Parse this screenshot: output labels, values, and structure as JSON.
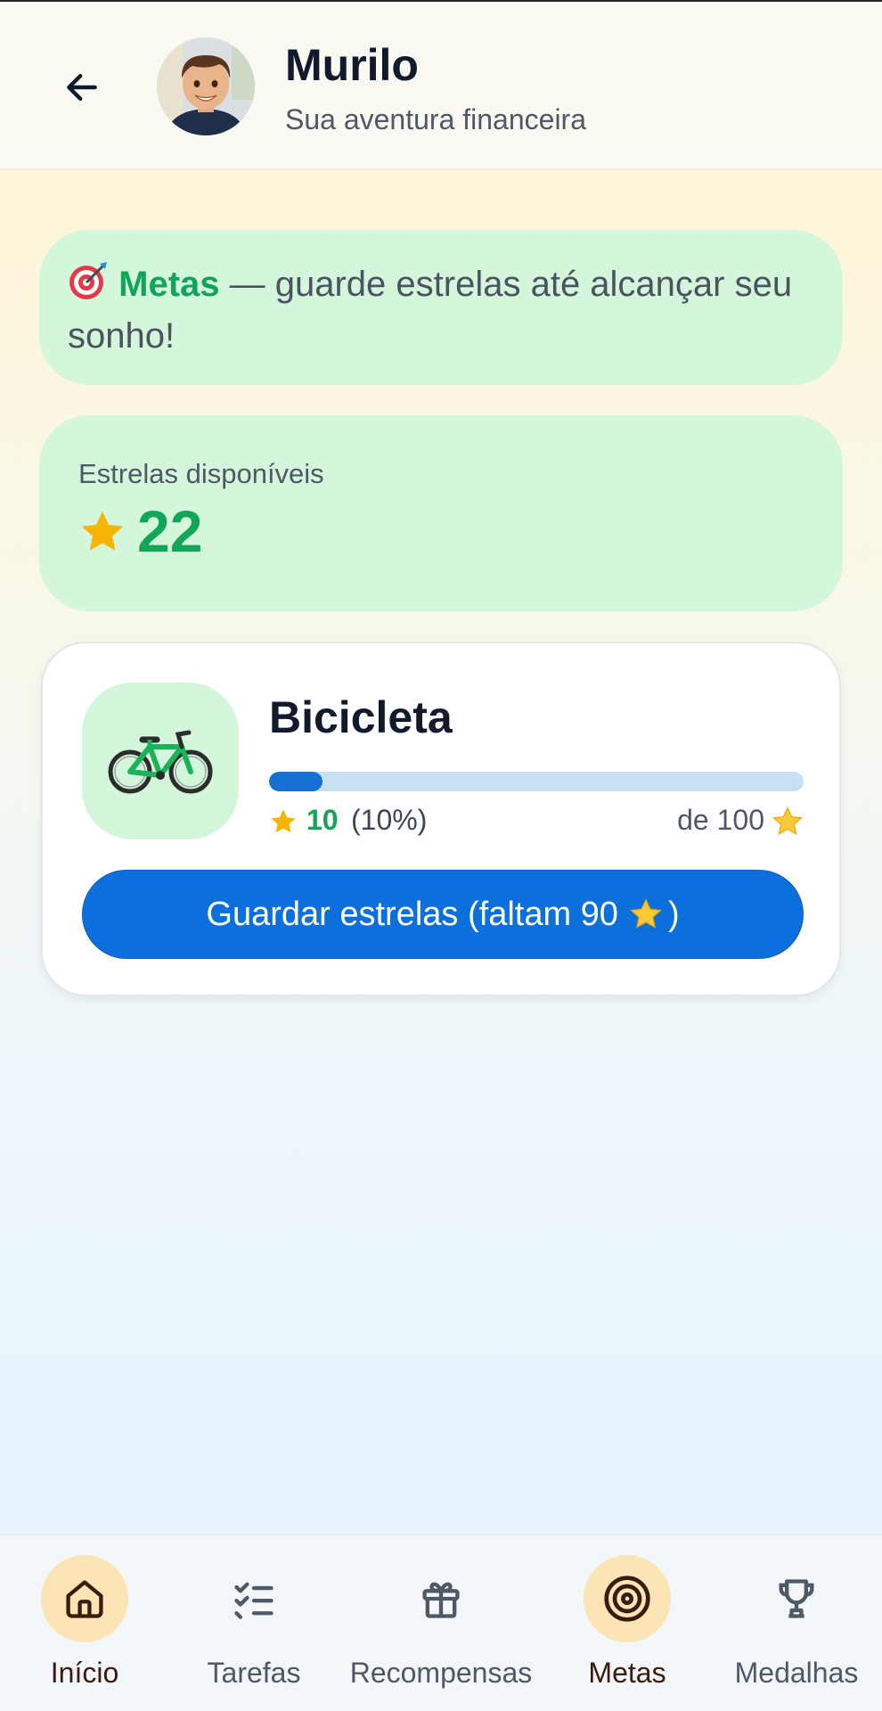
{
  "header": {
    "name": "Murilo",
    "subtitle": "Sua aventura financeira"
  },
  "banner": {
    "emoji": "target-icon",
    "title": "Metas",
    "text": " — guarde estrelas até alcançar seu sonho!"
  },
  "stars": {
    "label": "Estrelas disponíveis",
    "value": "22"
  },
  "goal": {
    "title": "Bicicleta",
    "icon": "bicycle-icon",
    "current": "10",
    "percent_label": "(10%)",
    "progress_fraction": 0.1,
    "target_label": "de 100",
    "button_label": "Guardar estrelas (faltam 90",
    "button_suffix": ")"
  },
  "nav": {
    "items": [
      {
        "label": "Início",
        "icon": "home-icon",
        "active": true
      },
      {
        "label": "Tarefas",
        "icon": "checklist-icon",
        "active": false
      },
      {
        "label": "Recompensas",
        "icon": "gift-icon",
        "active": false
      },
      {
        "label": "Metas",
        "icon": "target-icon",
        "active": true
      },
      {
        "label": "Medalhas",
        "icon": "trophy-icon",
        "active": false
      }
    ]
  },
  "colors": {
    "accent_green": "#13a657",
    "primary_blue": "#0b6fdc",
    "card_green": "#d4f7dc",
    "nav_active": "#fce5b4"
  }
}
